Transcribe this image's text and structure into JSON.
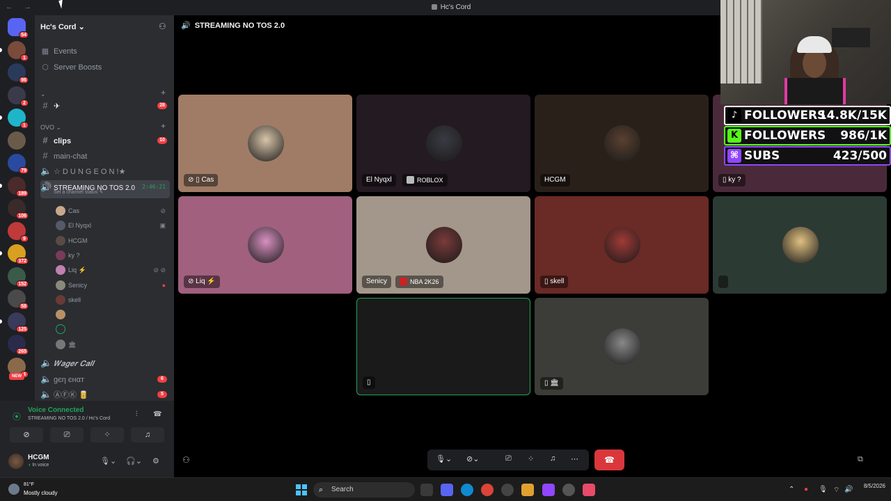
{
  "window": {
    "title": "Hc's Cord",
    "nav": "← →"
  },
  "server": {
    "name": "Hc's Cord"
  },
  "guild_badges": [
    "54",
    "1",
    "96",
    "2",
    "1",
    "",
    "79",
    "189",
    "106",
    "9",
    "372",
    "152",
    "58",
    "125",
    "265",
    "4"
  ],
  "sidebar": {
    "events": "Events",
    "boosts": "Server Boosts",
    "cat1": "⌄",
    "cat2": "OVO ⌄",
    "channels": [
      {
        "name": "✈",
        "badge": "28"
      },
      {
        "name": "clips",
        "badge": "10"
      },
      {
        "name": "main-chat",
        "badge": ""
      },
      {
        "name": "☆ D U N G E O N !★",
        "badge": ""
      }
    ],
    "voice_channel": {
      "name": "STREAMING NO TOS 2.0",
      "timer": "2:46:21",
      "status": "Set a channel status ✎"
    },
    "voice_users": [
      {
        "name": "Cas",
        "icons": "⊘"
      },
      {
        "name": "El Nyqxl",
        "icons": "▣"
      },
      {
        "name": "HCGM",
        "icons": ""
      },
      {
        "name": "ky ?",
        "icons": ""
      },
      {
        "name": "Liq ⚡",
        "icons": "⊘ ⊘"
      },
      {
        "name": "Senicy",
        "icons": "●"
      },
      {
        "name": "skell",
        "icons": ""
      },
      {
        "name": "",
        "icons": ""
      },
      {
        "name": "",
        "icons": ""
      },
      {
        "name": "🏛",
        "icons": ""
      }
    ],
    "more_channels": [
      {
        "name": "𝑾𝒂𝒈𝒆𝒓 𝑪𝒂𝒍𝒍",
        "badge": ""
      },
      {
        "name": "ɡєη єнαт",
        "badge": "6"
      },
      {
        "name": "ⒶⒻⓀ 🥫",
        "badge": "5"
      }
    ]
  },
  "panel": {
    "voice_connected": "Voice Connected",
    "voice_sub": "STREAMING NO TOS 2.0 / Hc's Cord",
    "username": "HCGM",
    "user_status": "In voice"
  },
  "main": {
    "channel_title": "STREAMING NO TOS 2.0"
  },
  "tiles": [
    {
      "label": "⊘ ▯ Cas",
      "activity": "",
      "bg": "#a07c66",
      "av": "#d8c4a8"
    },
    {
      "label": "El Nyqxl",
      "activity": "ROBLOX",
      "bg": "#241a22",
      "av": "#3a3a44"
    },
    {
      "label": "HCGM",
      "activity": "",
      "bg": "#2a201a",
      "av": "#5a4030"
    },
    {
      "label": "▯ ky ?",
      "activity": "",
      "bg": "#4a2a3a",
      "av": "#6a3a4a"
    },
    {
      "label": "⊘ Liq ⚡",
      "activity": "",
      "bg": "#a0607e",
      "av": "#d890c0"
    },
    {
      "label": "Senicy",
      "activity": "NBA 2K26",
      "bg": "#a2978a",
      "av": "#7a3a3a"
    },
    {
      "label": "▯ skell",
      "activity": "",
      "bg": "#6a2a26",
      "av": "#a03a36"
    },
    {
      "label": "",
      "activity": "",
      "bg": "#2c3a34",
      "av": "#e0c080"
    },
    {
      "label": "▯",
      "activity": "",
      "bg": "#1a1a1a",
      "av": ""
    },
    {
      "label": "▯ 🏛",
      "activity": "",
      "bg": "#3c3c38",
      "av": "#888"
    }
  ],
  "overlay": {
    "stats": [
      {
        "label": "FOLLOWERS",
        "value": "14.8K/15K",
        "color": "#ffffff",
        "icon": "♪"
      },
      {
        "label": "FOLLOWERS",
        "value": "986/1K",
        "color": "#53fc18",
        "icon": "K"
      },
      {
        "label": "SUBS",
        "value": "423/500",
        "color": "#9146ff",
        "icon": "⌘"
      }
    ]
  },
  "taskbar": {
    "temp": "81°F",
    "weather": "Mostly cloudy",
    "search": "Search",
    "date": "8/5/2026"
  }
}
